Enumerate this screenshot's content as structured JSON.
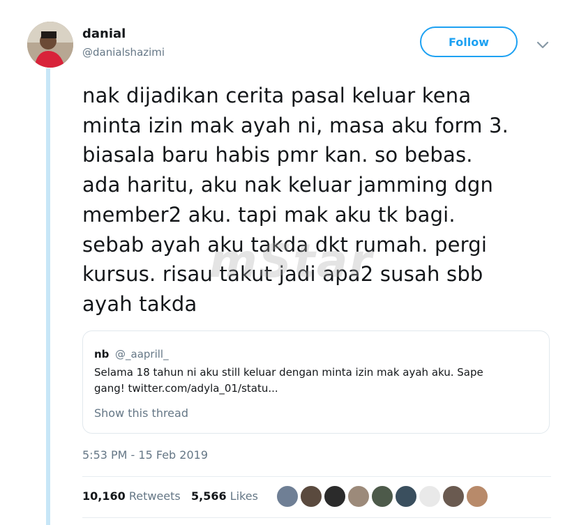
{
  "author": {
    "name": "danial",
    "handle": "@danialshazimi"
  },
  "follow_button": {
    "label": "Follow"
  },
  "tweet": {
    "lines": [
      "nak dijadikan cerita pasal keluar kena",
      "minta izin mak ayah ni, masa aku form 3.",
      "biasala baru habis pmr kan. so bebas.",
      "ada haritu, aku nak keluar jamming dgn",
      "member2 aku. tapi mak aku tk bagi.",
      "sebab ayah aku takda dkt rumah. pergi",
      "kursus. risau takut jadi apa2 susah sbb",
      "ayah takda"
    ]
  },
  "watermark": {
    "text": "mStar"
  },
  "quoted_tweet": {
    "name": "nb",
    "handle": "@_aaprill_",
    "lines": [
      "Selama 18 tahun ni aku still keluar dengan minta izin mak ayah aku. Sape",
      "gang! twitter.com/adyla_01/statu..."
    ],
    "show_thread": "Show this thread"
  },
  "timestamp": "5:53 PM - 15 Feb 2019",
  "stats": {
    "retweets_count": "10,160",
    "retweets_label": "Retweets",
    "likes_count": "5,566",
    "likes_label": "Likes"
  },
  "colors": {
    "accent": "#1da1f2",
    "thread_line": "#c7e6f7",
    "secondary_text": "#657786"
  },
  "liker_avatars": [
    {
      "name": "liker-avatar-1",
      "color": "#6f7f95"
    },
    {
      "name": "liker-avatar-2",
      "color": "#5a4a3e"
    },
    {
      "name": "liker-avatar-3",
      "color": "#2b2b2b"
    },
    {
      "name": "liker-avatar-4",
      "color": "#9c8a7a"
    },
    {
      "name": "liker-avatar-5",
      "color": "#4d5a4a"
    },
    {
      "name": "liker-avatar-6",
      "color": "#3a4f5e"
    },
    {
      "name": "liker-avatar-7",
      "color": "#e9e9e9"
    },
    {
      "name": "liker-avatar-8",
      "color": "#6a5a50"
    },
    {
      "name": "liker-avatar-9",
      "color": "#b88a6a"
    }
  ]
}
